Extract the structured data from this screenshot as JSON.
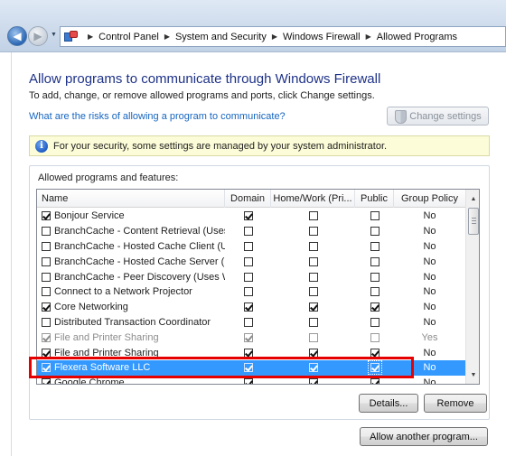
{
  "address_bar": {
    "breadcrumbs": [
      "Control Panel",
      "System and Security",
      "Windows Firewall",
      "Allowed Programs"
    ]
  },
  "page": {
    "title": "Allow programs to communicate through Windows Firewall",
    "subtitle": "To add, change, or remove allowed programs and ports, click Change settings.",
    "risk_link": "What are the risks of allowing a program to communicate?",
    "change_settings_label": "Change settings",
    "info_message": "For your security, some settings are managed by your system administrator."
  },
  "group": {
    "label": "Allowed programs and features:",
    "columns": [
      "Name",
      "Domain",
      "Home/Work (Pri...",
      "Public",
      "Group Policy"
    ],
    "rows": [
      {
        "name": "Bonjour Service",
        "enabled": true,
        "domain": true,
        "home": false,
        "public": false,
        "policy": "No"
      },
      {
        "name": "BranchCache - Content Retrieval (Uses ...",
        "enabled": false,
        "domain": false,
        "home": false,
        "public": false,
        "policy": "No"
      },
      {
        "name": "BranchCache - Hosted Cache Client (U...",
        "enabled": false,
        "domain": false,
        "home": false,
        "public": false,
        "policy": "No"
      },
      {
        "name": "BranchCache - Hosted Cache Server (U...",
        "enabled": false,
        "domain": false,
        "home": false,
        "public": false,
        "policy": "No"
      },
      {
        "name": "BranchCache - Peer Discovery (Uses W...",
        "enabled": false,
        "domain": false,
        "home": false,
        "public": false,
        "policy": "No"
      },
      {
        "name": "Connect to a Network Projector",
        "enabled": false,
        "domain": false,
        "home": false,
        "public": false,
        "policy": "No"
      },
      {
        "name": "Core Networking",
        "enabled": true,
        "domain": true,
        "home": true,
        "public": true,
        "policy": "No"
      },
      {
        "name": "Distributed Transaction Coordinator",
        "enabled": false,
        "domain": false,
        "home": false,
        "public": false,
        "policy": "No"
      },
      {
        "name": "File and Printer Sharing",
        "enabled": true,
        "domain": true,
        "home": false,
        "public": false,
        "policy": "Yes",
        "managed": true
      },
      {
        "name": "File and Printer Sharing",
        "enabled": true,
        "domain": true,
        "home": true,
        "public": true,
        "policy": "No"
      },
      {
        "name": "Flexera Software LLC",
        "enabled": true,
        "domain": true,
        "home": true,
        "public": true,
        "policy": "No",
        "selected": true
      },
      {
        "name": "Google Chrome",
        "enabled": true,
        "domain": true,
        "home": true,
        "public": true,
        "policy": "No"
      }
    ]
  },
  "buttons": {
    "details": "Details...",
    "remove": "Remove",
    "allow_another": "Allow another program..."
  },
  "colors": {
    "title": "#1e3287",
    "link": "#1565c0",
    "selection": "#3399ff",
    "highlight_box": "#e60000",
    "info_bar": "#fcfcd8"
  }
}
